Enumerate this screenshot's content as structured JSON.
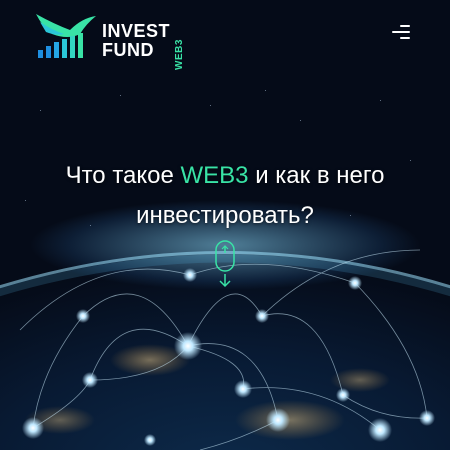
{
  "brand": {
    "line1": "INVEST",
    "line2": "FUND",
    "tag": "WEB3",
    "accent_color": "#39e3a6",
    "icon": "bird-bars-logo"
  },
  "menu": {
    "icon": "hamburger-menu-icon"
  },
  "hero": {
    "title_before": "Что такое ",
    "title_highlight": "WEB3",
    "title_after": " и как в него",
    "title_line2": "инвестировать?"
  },
  "scroll": {
    "icon": "mouse-scroll-down-icon"
  }
}
